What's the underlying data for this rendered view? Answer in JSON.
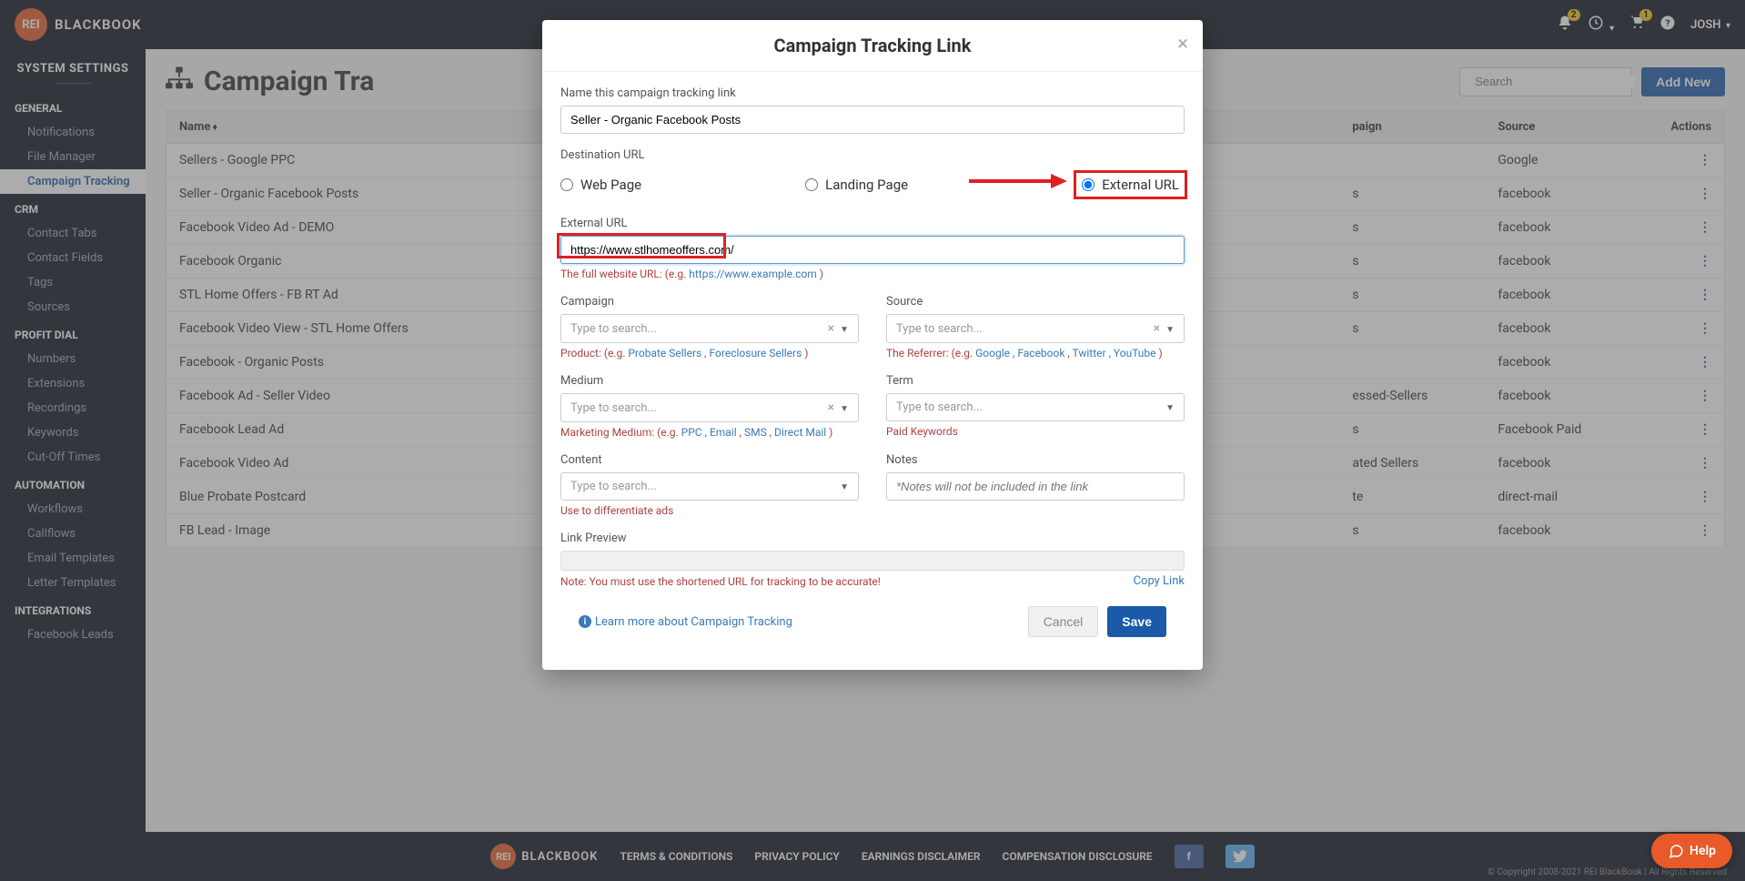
{
  "brand": {
    "initials": "REI",
    "name": "BLACKBOOK"
  },
  "topbar": {
    "notif_badge": "2",
    "cart_badge": "1",
    "user": "JOSH"
  },
  "sidebar": {
    "title": "SYSTEM SETTINGS",
    "groups": [
      {
        "header": "GENERAL",
        "items": [
          "Notifications",
          "File Manager",
          "Campaign Tracking"
        ],
        "activeIndex": 2
      },
      {
        "header": "CRM",
        "items": [
          "Contact Tabs",
          "Contact Fields",
          "Tags",
          "Sources"
        ]
      },
      {
        "header": "PROFIT DIAL",
        "items": [
          "Numbers",
          "Extensions",
          "Recordings",
          "Keywords",
          "Cut-Off Times"
        ]
      },
      {
        "header": "AUTOMATION",
        "items": [
          "Workflows",
          "Callflows",
          "Email Templates",
          "Letter Templates"
        ]
      },
      {
        "header": "INTEGRATIONS",
        "items": [
          "Facebook Leads"
        ]
      }
    ]
  },
  "page": {
    "title": "Campaign Tra",
    "search_placeholder": "Search",
    "add_new": "Add New"
  },
  "table": {
    "col_name": "Name",
    "col_campaign": "paign",
    "col_source": "Source",
    "col_actions": "Actions",
    "rows": [
      {
        "name": "Sellers - Google PPC",
        "campaign": "",
        "source": "Google"
      },
      {
        "name": "Seller - Organic Facebook Posts",
        "campaign": "s",
        "source": "facebook"
      },
      {
        "name": "Facebook Video Ad - DEMO",
        "campaign": "s",
        "source": "facebook"
      },
      {
        "name": "Facebook Organic",
        "campaign": "s",
        "source": "facebook"
      },
      {
        "name": "STL Home Offers - FB RT Ad",
        "campaign": "s",
        "source": "facebook"
      },
      {
        "name": "Facebook Video View - STL Home Offers",
        "campaign": "s",
        "source": "facebook"
      },
      {
        "name": "Facebook - Organic Posts",
        "campaign": "",
        "source": "facebook"
      },
      {
        "name": "Facebook Ad - Seller Video",
        "campaign": "essed-Sellers",
        "source": "facebook"
      },
      {
        "name": "Facebook Lead Ad",
        "campaign": "s",
        "source": "Facebook Paid"
      },
      {
        "name": "Facebook Video Ad",
        "campaign": "ated Sellers",
        "source": "facebook"
      },
      {
        "name": "Blue Probate Postcard",
        "campaign": "te",
        "source": "direct-mail"
      },
      {
        "name": "FB Lead - Image",
        "campaign": "s",
        "source": "facebook"
      }
    ]
  },
  "modal": {
    "title": "Campaign Tracking Link",
    "name_label": "Name this campaign tracking link",
    "name_value": "Seller - Organic Facebook Posts",
    "dest_label": "Destination URL",
    "dest_options": {
      "web": "Web Page",
      "landing": "Landing Page",
      "external": "External URL"
    },
    "ext_label": "External URL",
    "ext_value": "https://www.stlhomeoffers.com/",
    "ext_help_prefix": "The full website URL: (e.g. ",
    "ext_help_link": "https://www.example.com",
    "campaign_label": "Campaign",
    "campaign_help": "Product: (e.g. ",
    "campaign_tags": [
      "Probate Sellers",
      "Foreclosure Sellers"
    ],
    "source_label": "Source",
    "source_help": "The Referrer: (e.g. ",
    "source_tags": [
      "Google",
      "Facebook",
      "Twitter",
      "YouTube"
    ],
    "medium_label": "Medium",
    "medium_help": "Marketing Medium: (e.g. ",
    "medium_tags": [
      "PPC",
      "Email",
      "SMS",
      "Direct Mail"
    ],
    "term_label": "Term",
    "term_help": "Paid Keywords",
    "content_label": "Content",
    "content_help": "Use to differentiate ads",
    "notes_label": "Notes",
    "notes_placeholder": "*Notes will not be included in the link",
    "preview_label": "Link Preview",
    "preview_note": "Note: You must use the shortened URL for tracking to be accurate!",
    "copy_link": "Copy Link",
    "learn_more": "Learn more about Campaign Tracking",
    "cancel": "Cancel",
    "save": "Save",
    "type_to_search": "Type to search..."
  },
  "footer": {
    "links": [
      "TERMS & CONDITIONS",
      "PRIVACY POLICY",
      "EARNINGS DISCLAIMER",
      "COMPENSATION DISCLOSURE"
    ],
    "copyright": "© Copyright 2008-2021 REI BlackBook | All Rights Reserved"
  },
  "help": "Help"
}
